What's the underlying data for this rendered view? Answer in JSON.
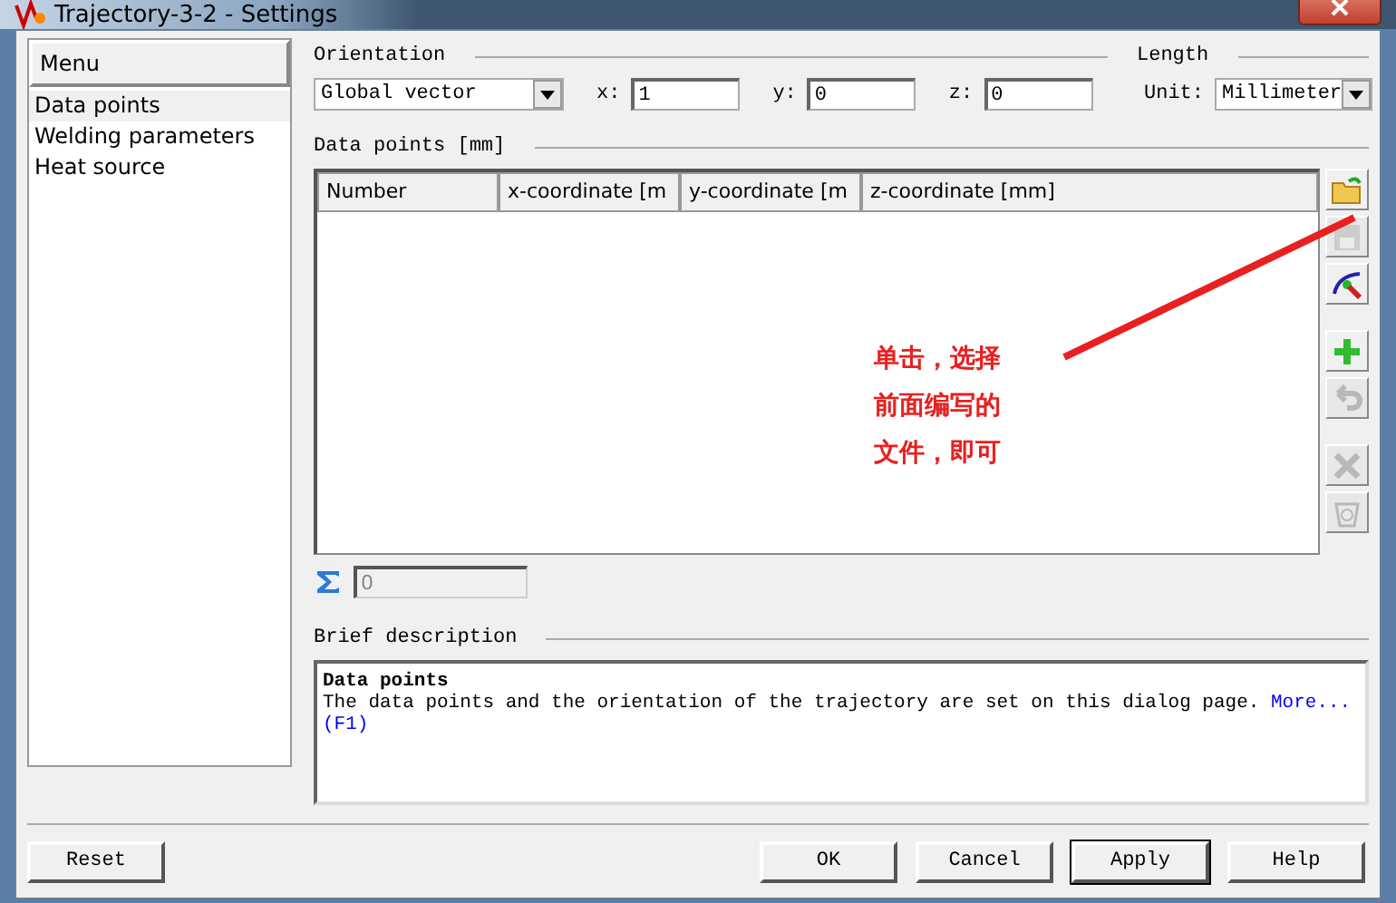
{
  "window": {
    "title": "Trajectory-3-2 - Settings"
  },
  "menu": {
    "heading": "Menu",
    "items": [
      {
        "label": "Data points",
        "selected": true
      },
      {
        "label": "Welding parameters",
        "selected": false
      },
      {
        "label": "Heat source",
        "selected": false
      }
    ]
  },
  "orientation": {
    "heading": "Orientation",
    "mode": "Global vector",
    "fields": [
      {
        "label": "x:",
        "value": "1"
      },
      {
        "label": "y:",
        "value": "0"
      },
      {
        "label": "z:",
        "value": "0"
      }
    ]
  },
  "length": {
    "heading": "Length",
    "label": "Unit:",
    "unit": "Millimeter"
  },
  "data_points": {
    "heading": "Data points [mm]",
    "columns": [
      "Number",
      "x-coordinate [m",
      "y-coordinate [m",
      "z-coordinate [mm]"
    ],
    "tools": [
      {
        "kind": "open",
        "disabled": false
      },
      {
        "kind": "save",
        "disabled": true
      },
      {
        "kind": "curve",
        "disabled": false
      },
      {
        "kind": "spacer"
      },
      {
        "kind": "add",
        "disabled": false
      },
      {
        "kind": "undo",
        "disabled": true
      },
      {
        "kind": "spacer"
      },
      {
        "kind": "delete",
        "disabled": true
      },
      {
        "kind": "recycle",
        "disabled": true
      }
    ],
    "sum": "0"
  },
  "annotation": {
    "lines": [
      "单击，选择",
      "前面编写的",
      "文件，即可"
    ]
  },
  "description": {
    "heading": "Brief description",
    "title": "Data points",
    "text": "The data points and the orientation of the trajectory are set on this dialog page.",
    "link": "More...",
    "key": "(F1)"
  },
  "buttons_left": [
    "Reset"
  ],
  "buttons_right": [
    "OK",
    "Cancel",
    "Apply",
    "Help"
  ]
}
